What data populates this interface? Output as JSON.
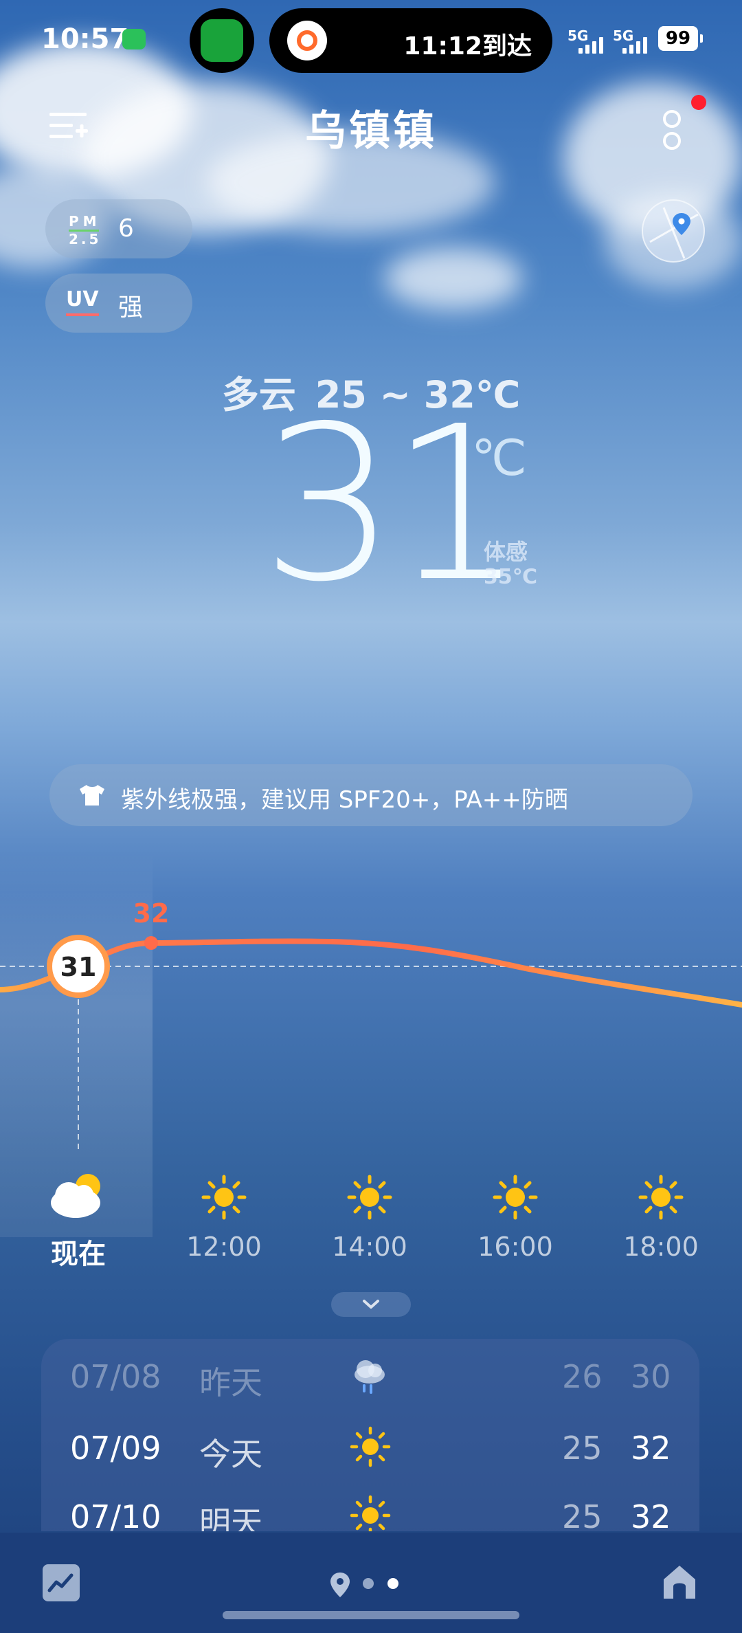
{
  "status_bar": {
    "time": "10:57",
    "island_text": "11:12到达",
    "signal_1": "5G",
    "signal_2": "5G",
    "battery": "99"
  },
  "header": {
    "city": "乌镇镇"
  },
  "air": {
    "pm_label_top": "PM",
    "pm_label_bottom": "2.5",
    "pm_value": "6",
    "uv_label": "UV",
    "uv_value": "强"
  },
  "current": {
    "condition": "多云",
    "range": "25 ~ 32℃",
    "temperature": "31",
    "unit": "℃",
    "feels_label": "体感",
    "feels_value": "35℃"
  },
  "advice": {
    "text": "紫外线极强，建议用 SPF20+，PA++防晒"
  },
  "hourly_chart": {
    "now_value": "31",
    "peak_label": "32"
  },
  "hourly": [
    {
      "label": "现在",
      "icon": "partly-cloudy-icon"
    },
    {
      "label": "12:00",
      "icon": "sun-icon"
    },
    {
      "label": "14:00",
      "icon": "sun-icon"
    },
    {
      "label": "16:00",
      "icon": "sun-icon"
    },
    {
      "label": "18:00",
      "icon": "sun-icon"
    }
  ],
  "daily": [
    {
      "date": "07/08",
      "relative": "昨天",
      "icon": "rain-cloud-icon",
      "low": "26",
      "high": "30"
    },
    {
      "date": "07/09",
      "relative": "今天",
      "icon": "sun-icon",
      "low": "25",
      "high": "32"
    },
    {
      "date": "07/10",
      "relative": "明天",
      "icon": "sun-icon",
      "low": "25",
      "high": "32"
    }
  ],
  "colors": {
    "curve_start": "#ffab45",
    "curve_mid": "#ff6b4a",
    "peak_label": "#ff6b4a",
    "sun": "#ffc414"
  }
}
